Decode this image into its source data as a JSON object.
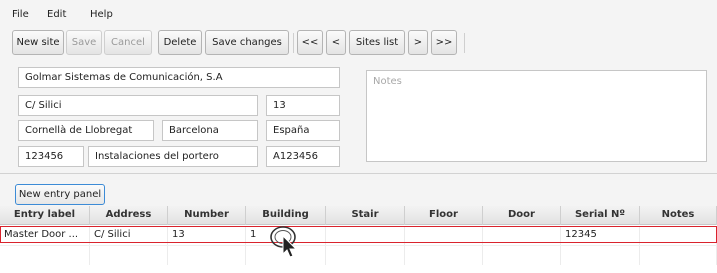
{
  "menu": {
    "file": "File",
    "edit": "Edit",
    "help": "Help"
  },
  "toolbar": {
    "new_site": "New site",
    "save": "Save",
    "cancel": "Cancel",
    "delete": "Delete",
    "save_changes": "Save changes",
    "first": "<<",
    "prev": "<",
    "sites_list": "Sites list",
    "next": ">",
    "last": ">>"
  },
  "form": {
    "company": "Golmar Sistemas de Comunicación, S.A",
    "street": "C/ Silici",
    "street_number": "13",
    "city": "Cornellà de Llobregat",
    "province": "Barcelona",
    "country": "España",
    "postal_code": "123456",
    "installation": "Instalaciones del portero",
    "code": "A123456",
    "notes_placeholder": "Notes"
  },
  "new_entry_panel_label": "New entry panel",
  "table": {
    "headers": [
      "Entry label",
      "Address",
      "Number",
      "Building",
      "Stair",
      "Floor",
      "Door",
      "Serial Nº",
      "Notes"
    ],
    "rows": [
      [
        "Master Door ...",
        "C/ Silici",
        "13",
        "1",
        "",
        "",
        "",
        "12345",
        ""
      ]
    ]
  },
  "colors": {
    "highlight": "#d9232d",
    "focus": "#3c8bd6"
  },
  "icons": {
    "cursor": "mouse-pointer-icon"
  }
}
